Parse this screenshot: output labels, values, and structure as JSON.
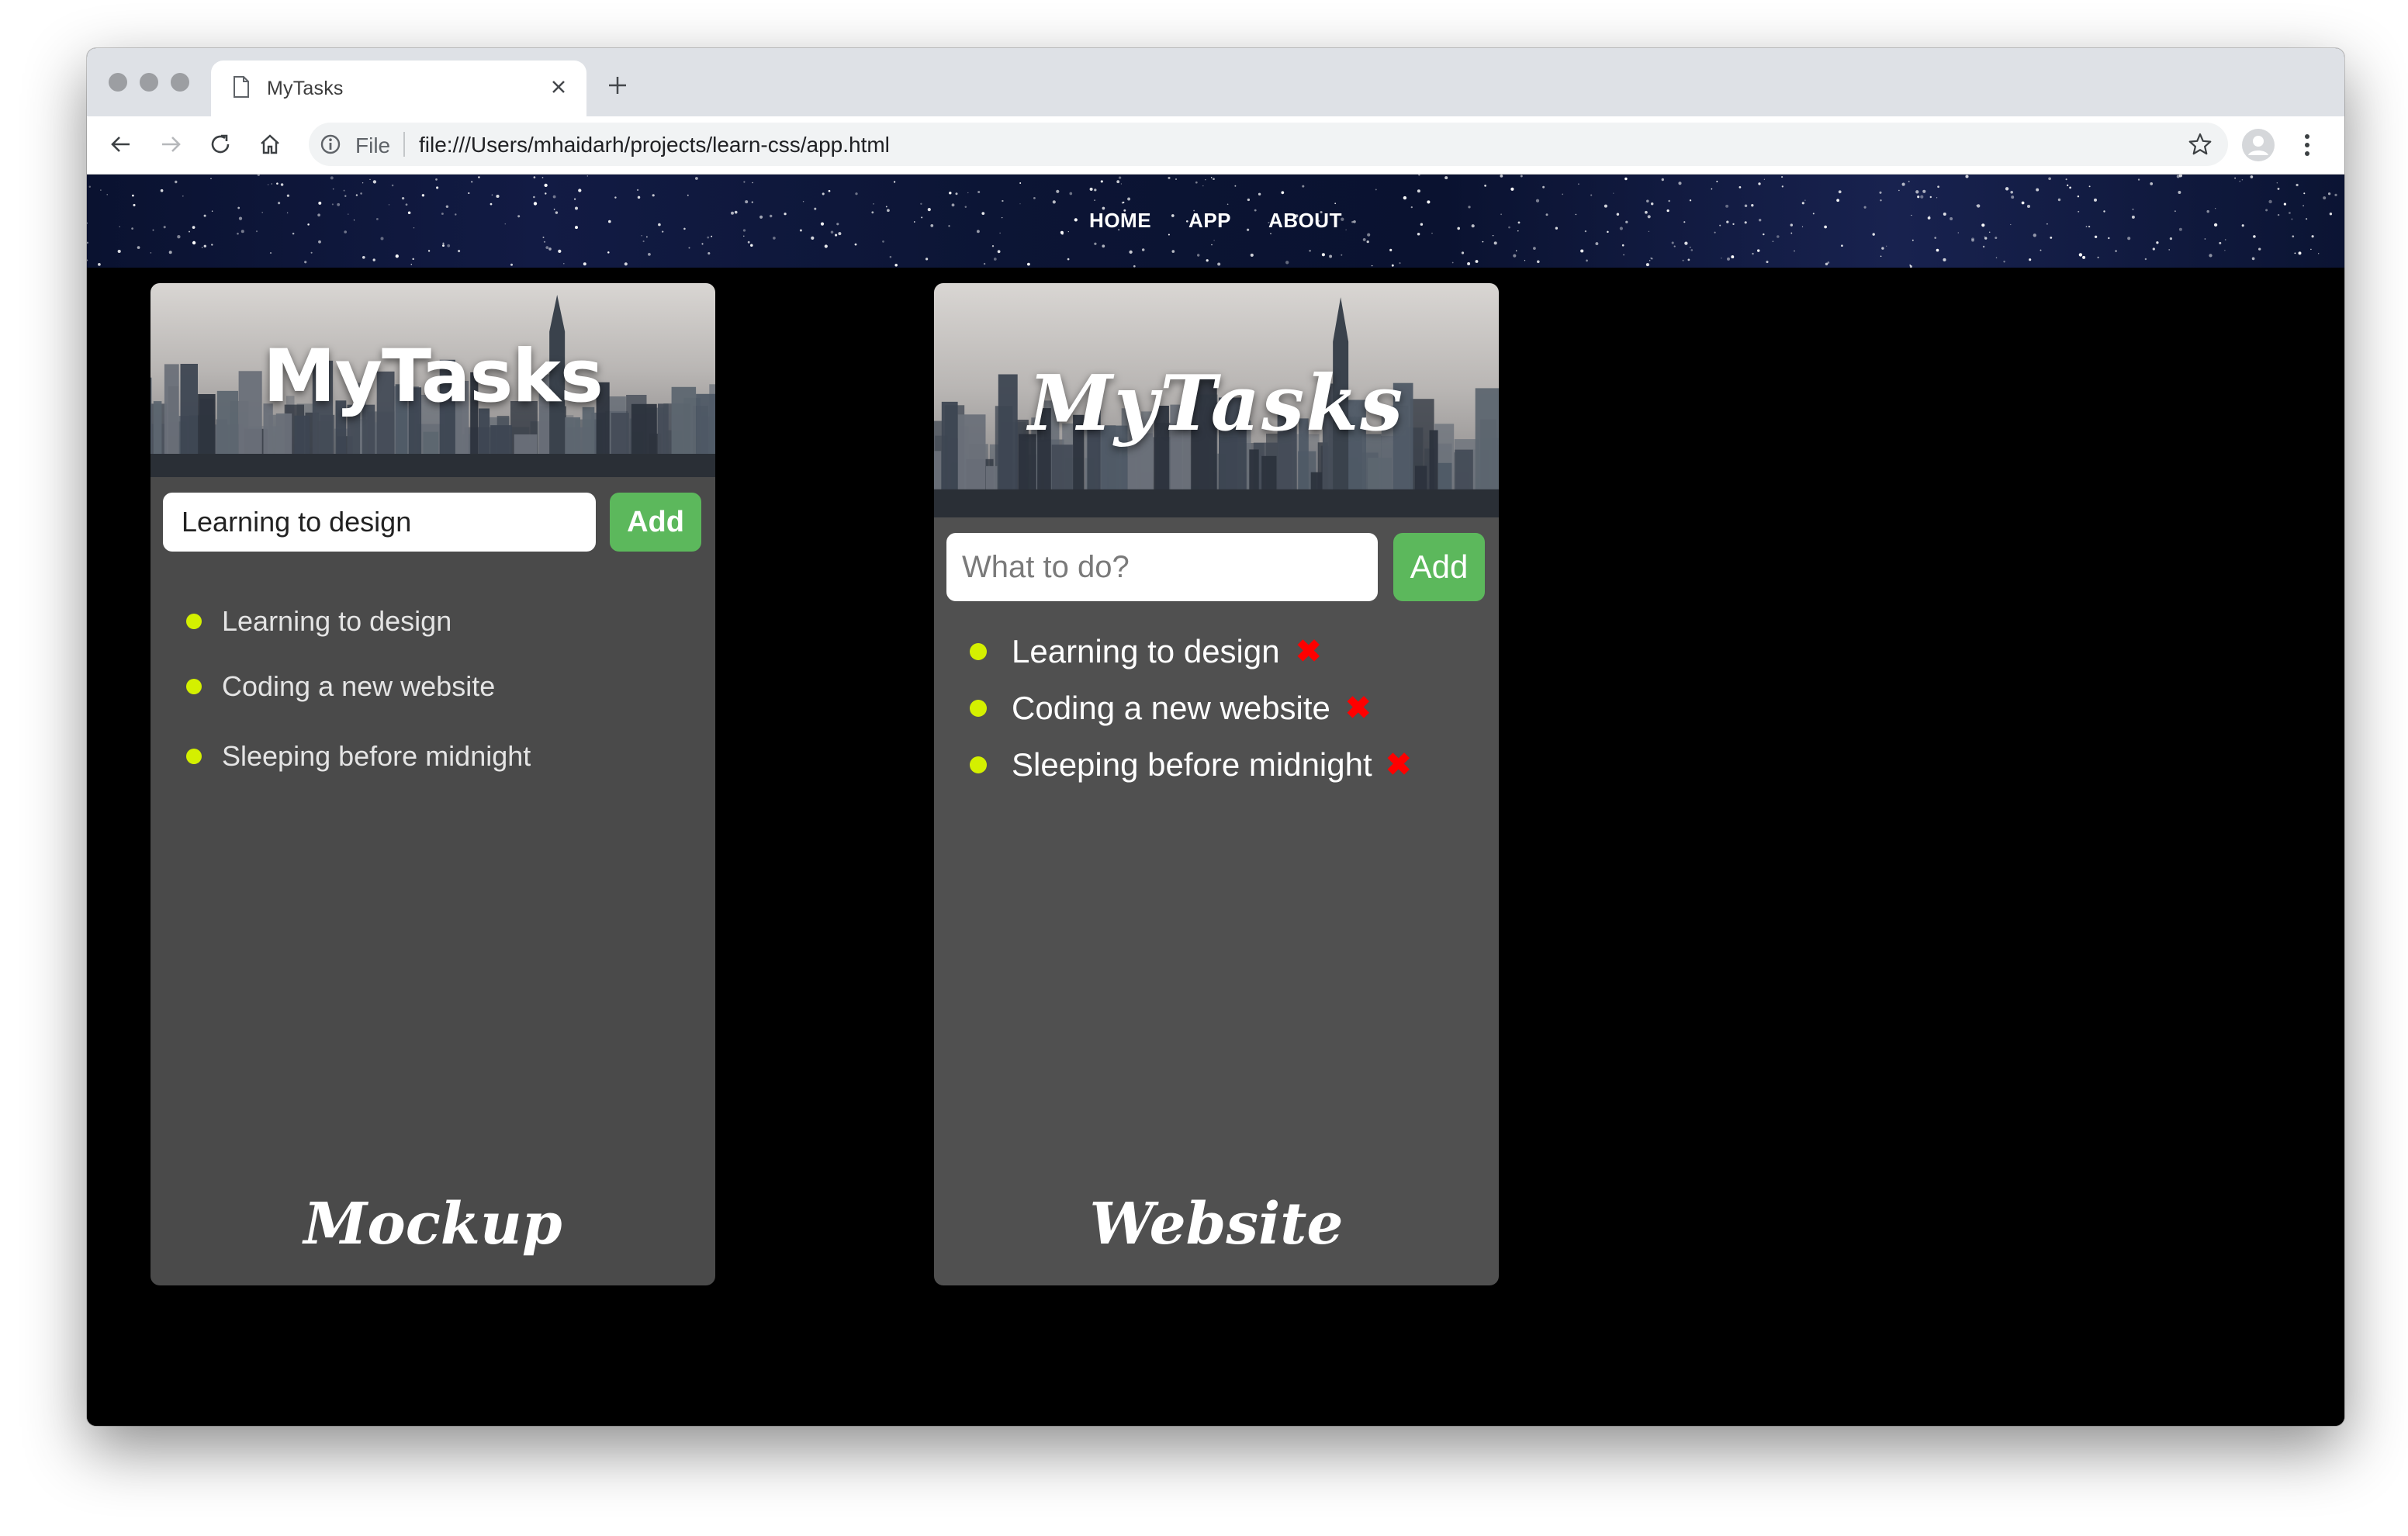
{
  "browser": {
    "tab_title": "MyTasks",
    "url_scheme_label": "File",
    "url": "file:///Users/mhaidarh/projects/learn-css/app.html"
  },
  "nav": {
    "links": [
      "HOME",
      "APP",
      "ABOUT"
    ]
  },
  "mockup": {
    "title": "MyTasks",
    "input_value": "Learning to design",
    "add_label": "Add",
    "tasks": [
      "Learning to design",
      "Coding a new website",
      "Sleeping before midnight"
    ],
    "caption": "Mockup"
  },
  "website": {
    "title": "MyTasks",
    "input_placeholder": "What to do?",
    "add_label": "Add",
    "tasks": [
      "Learning to design",
      "Coding a new website",
      "Sleeping before midnight"
    ],
    "delete_glyph": "✖",
    "caption": "Website"
  },
  "colors": {
    "add_button": "#5cb85c",
    "bullet": "#d4f000",
    "delete": "#ff0000",
    "card_bg": "#4a4a4a",
    "page_bg": "#000000"
  },
  "icons": [
    "page-icon",
    "close-icon",
    "plus-icon",
    "back-arrow-icon",
    "forward-arrow-icon",
    "reload-icon",
    "home-icon",
    "info-icon",
    "star-icon",
    "avatar-icon",
    "kebab-menu-icon"
  ]
}
